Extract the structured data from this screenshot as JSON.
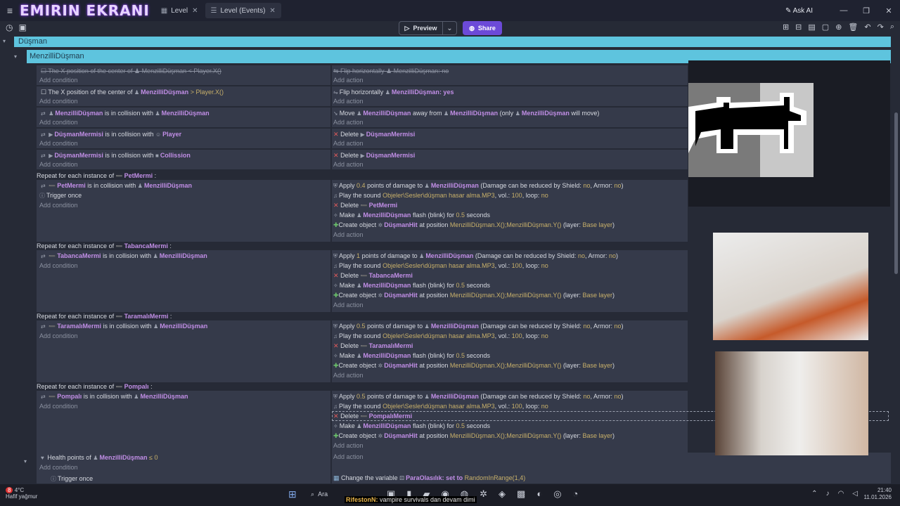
{
  "titlebar": {
    "brand": "EMIRIN EKRANI",
    "tabs": [
      {
        "label": "Level"
      },
      {
        "label": "Level (Events)"
      }
    ],
    "ask_ai": "Ask AI"
  },
  "toolbar": {
    "preview": "Preview",
    "share": "Share"
  },
  "groups": {
    "outer": "Düşman",
    "inner": "MenzilliDüşman"
  },
  "common": {
    "add_condition": "Add condition",
    "add_action": "Add action"
  },
  "events": {
    "e1": {
      "c_a": "The X position of the center of",
      "c_obj": "MenzilliDüşman",
      "c_b": "< Player.X()",
      "a_a": "Flip horizontally",
      "a_obj": "MenzilliDüşman",
      "a_b": ": no"
    },
    "e2": {
      "c_a": "The X position of the center of",
      "c_obj": "MenzilliDüşman",
      "c_b": "> Player.X()",
      "a_a": "Flip horizontally",
      "a_obj": "MenzilliDüşman",
      "a_b": ": yes"
    },
    "e3": {
      "c_obj1": "MenzilliDüşman",
      "c_mid": "is in collision with",
      "c_obj2": "MenzilliDüşman",
      "a_a": "Move",
      "a_obj1": "MenzilliDüşman",
      "a_mid": "away from",
      "a_obj2": "MenzilliDüşman",
      "a_b": "(only",
      "a_obj3": "MenzilliDüşman",
      "a_c": "will move)"
    },
    "e4": {
      "c_obj1": "DüşmanMermisi",
      "c_mid": "is in collision with",
      "c_obj2": "Player",
      "a_a": "Delete",
      "a_obj": "DüşmanMermisi"
    },
    "e5": {
      "c_obj1": "DüşmanMermisi",
      "c_mid": "is in collision with",
      "c_obj2": "Collission",
      "a_a": "Delete",
      "a_obj": "DüşmanMermisi"
    }
  },
  "repeats": [
    {
      "label": "Repeat for each instance of",
      "object": "PetMermi",
      "cond_obj1": "PetMermi",
      "cond_mid": "is in collision with",
      "cond_obj2": "MenzilliDüşman",
      "trigger": "Trigger once",
      "dmg_a": "Apply",
      "dmg_val": "0.4",
      "dmg_b": "points of damage to",
      "dmg_obj": "MenzilliDüşman",
      "dmg_c": "(Damage can be reduced by Shield:",
      "dmg_no1": "no",
      "dmg_d": ", Armor:",
      "dmg_no2": "no",
      "dmg_e": ")",
      "sound_a": "Play the sound",
      "sound_file": "Objeler\\Sesler\\düşman hasar alma.MP3",
      "sound_b": ", vol.:",
      "sound_vol": "100",
      "sound_c": ", loop:",
      "sound_loop": "no",
      "del_a": "Delete",
      "del_obj": "PetMermi",
      "make_a": "Make",
      "make_obj": "MenzilliDüşman",
      "make_b": "flash (blink) for",
      "make_val": "0.5",
      "make_c": "seconds",
      "create_a": "Create object",
      "create_obj": "DüşmanHit",
      "create_b": "at position",
      "create_pos": "MenzilliDüşman.X();MenzilliDüşman.Y()",
      "create_c": "(layer:",
      "create_layer": "Base layer",
      "create_d": ")"
    },
    {
      "label": "Repeat for each instance of",
      "object": "TabancaMermi",
      "cond_obj1": "TabancaMermi",
      "cond_mid": "is in collision with",
      "cond_obj2": "MenzilliDüşman",
      "dmg_a": "Apply",
      "dmg_val": "1",
      "dmg_b": "points of damage to",
      "dmg_obj": "MenzilliDüşman",
      "dmg_c": "(Damage can be reduced by Shield:",
      "dmg_no1": "no",
      "dmg_d": ", Armor:",
      "dmg_no2": "no",
      "dmg_e": ")",
      "sound_a": "Play the sound",
      "sound_file": "Objeler\\Sesler\\düşman hasar alma.MP3",
      "sound_b": ", vol.:",
      "sound_vol": "100",
      "sound_c": ", loop:",
      "sound_loop": "no",
      "del_a": "Delete",
      "del_obj": "TabancaMermi",
      "make_a": "Make",
      "make_obj": "MenzilliDüşman",
      "make_b": "flash (blink) for",
      "make_val": "0.5",
      "make_c": "seconds",
      "create_a": "Create object",
      "create_obj": "DüşmanHit",
      "create_b": "at position",
      "create_pos": "MenzilliDüşman.X();MenzilliDüşman.Y()",
      "create_c": "(layer:",
      "create_layer": "Base layer",
      "create_d": ")"
    },
    {
      "label": "Repeat for each instance of",
      "object": "TaramalıMermi",
      "cond_obj1": "TaramalıMermi",
      "cond_mid": "is in collision with",
      "cond_obj2": "MenzilliDüşman",
      "dmg_a": "Apply",
      "dmg_val": "0.5",
      "dmg_b": "points of damage to",
      "dmg_obj": "MenzilliDüşman",
      "dmg_c": "(Damage can be reduced by Shield:",
      "dmg_no1": "no",
      "dmg_d": ", Armor:",
      "dmg_no2": "no",
      "dmg_e": ")",
      "sound_a": "Play the sound",
      "sound_file": "Objeler\\Sesler\\düşman hasar alma.MP3",
      "sound_b": ", vol.:",
      "sound_vol": "100",
      "sound_c": ", loop:",
      "sound_loop": "no",
      "del_a": "Delete",
      "del_obj": "TaramalıMermi",
      "make_a": "Make",
      "make_obj": "MenzilliDüşman",
      "make_b": "flash (blink) for",
      "make_val": "0.5",
      "make_c": "seconds",
      "create_a": "Create object",
      "create_obj": "DüşmanHit",
      "create_b": "at position",
      "create_pos": "MenzilliDüşman.X();MenzilliDüşman.Y()",
      "create_c": "(layer:",
      "create_layer": "Base layer",
      "create_d": ")"
    },
    {
      "label": "Repeat for each instance of",
      "object": "Pompalı",
      "cond_obj1": "Pompalı",
      "cond_mid": "is in collision with",
      "cond_obj2": "MenzilliDüşman",
      "dmg_a": "Apply",
      "dmg_val": "0.5",
      "dmg_b": "points of damage to",
      "dmg_obj": "MenzilliDüşman",
      "dmg_c": "(Damage can be reduced by Shield:",
      "dmg_no1": "no",
      "dmg_d": ", Armor:",
      "dmg_no2": "no",
      "dmg_e": ")",
      "sound_a": "Play the sound",
      "sound_file": "Objeler\\Sesler\\düşman hasar alma.MP3",
      "sound_b": ", vol.:",
      "sound_vol": "100",
      "sound_c": ", loop:",
      "sound_loop": "no",
      "del_a": "Delete",
      "del_obj": "PompalıMermi",
      "make_a": "Make",
      "make_obj": "MenzilliDüşman",
      "make_b": "flash (blink) for",
      "make_val": "0.5",
      "make_c": "seconds",
      "create_a": "Create object",
      "create_obj": "DüşmanHit",
      "create_b": "at position",
      "create_pos": "MenzilliDüşman.X();MenzilliDüşman.Y()",
      "create_c": "(layer:",
      "create_layer": "Base layer",
      "create_d": ")"
    }
  ],
  "health": {
    "a": "Health points of",
    "obj": "MenzilliDüşman",
    "b": "≤ 0",
    "trigger": "Trigger once",
    "var_a": "Change the variable",
    "var_name": "ParaOlasılık",
    "var_b": ": set to",
    "var_val": "RandomInRange(1,4)"
  },
  "taskbar": {
    "temp": "4°C",
    "weather": "Hafif yağmur",
    "search": "Ara",
    "marquee_user": "RifestonN:",
    "marquee_text": "vampire survivals dan devam dimi",
    "time": "21:40",
    "date": "11.01.2026",
    "badge": "8"
  }
}
